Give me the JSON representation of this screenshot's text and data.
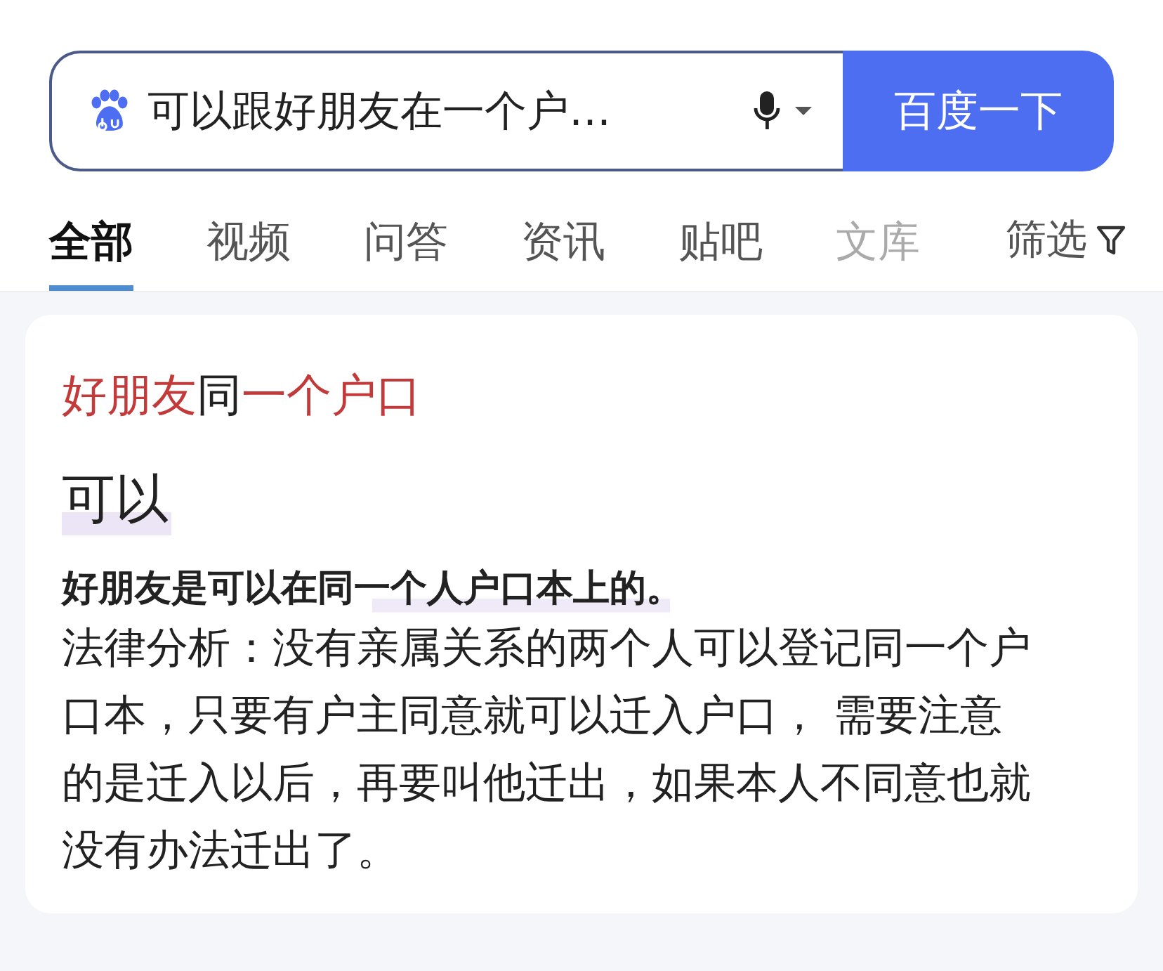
{
  "search": {
    "value": "可以跟好朋友在一个户…",
    "button": "百度一下"
  },
  "tabs": [
    {
      "label": "全部",
      "selected": true
    },
    {
      "label": "视频",
      "selected": false
    },
    {
      "label": "问答",
      "selected": false
    },
    {
      "label": "资讯",
      "selected": false
    },
    {
      "label": "贴吧",
      "selected": false
    },
    {
      "label": "文库",
      "selected": false
    }
  ],
  "filter": {
    "label": "筛选"
  },
  "card": {
    "title": [
      {
        "text": "好朋友",
        "highlight": true
      },
      {
        "text": "同",
        "highlight": false
      },
      {
        "text": "一个户口",
        "highlight": true
      }
    ],
    "answer": "可以",
    "summary": "好朋友是可以在同一个人户口本上的。",
    "body": "法律分析：没有亲属关系的两个人可以登记同一个户口本，只要有户主同意就可以迁入户口， 需要注意的是迁入以后，再要叫他迁出，如果本人不同意也就没有办法迁出了。"
  }
}
